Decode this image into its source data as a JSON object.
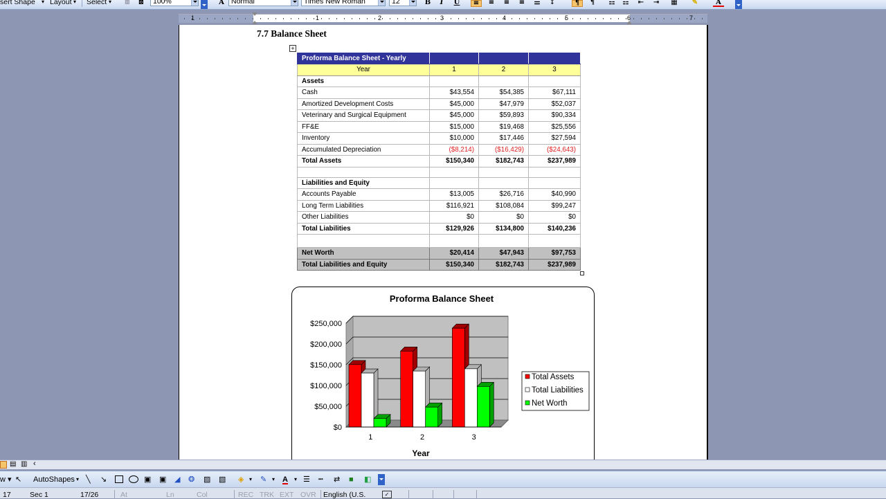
{
  "toolbar": {
    "insert_shape": "sert Shape",
    "layout": "Layout",
    "select": "Select",
    "zoom": "100%",
    "style": "Normal",
    "font": "Times New Roman",
    "size": "12",
    "bold": "B",
    "italic": "I",
    "underline": "U"
  },
  "ruler": {
    "numbers": [
      "1",
      "1",
      "2",
      "3",
      "4",
      "5",
      "6",
      "7"
    ]
  },
  "document": {
    "heading": "7.7 Balance Sheet",
    "table": {
      "title": "Proforma Balance Sheet - Yearly",
      "year_label": "Year",
      "years": [
        "1",
        "2",
        "3"
      ],
      "assets_header": "Assets",
      "assets": [
        {
          "label": "Cash",
          "values": [
            "$43,554",
            "$54,385",
            "$67,111"
          ]
        },
        {
          "label": "Amortized Development Costs",
          "values": [
            "$45,000",
            "$47,979",
            "$52,037"
          ]
        },
        {
          "label": "Veterinary and Surgical Equipment",
          "values": [
            "$45,000",
            "$59,893",
            "$90,334"
          ]
        },
        {
          "label": "FF&E",
          "values": [
            "$15,000",
            "$19,468",
            "$25,556"
          ]
        },
        {
          "label": "Inventory",
          "values": [
            "$10,000",
            "$17,446",
            "$27,594"
          ]
        },
        {
          "label": "Accumulated Depreciation",
          "values": [
            "($8,214)",
            "($16,429)",
            "($24,643)"
          ],
          "negative": true
        }
      ],
      "total_assets": {
        "label": "Total Assets",
        "values": [
          "$150,340",
          "$182,743",
          "$237,989"
        ]
      },
      "liabilities_header": "Liabilities and Equity",
      "liabilities": [
        {
          "label": "Accounts Payable",
          "values": [
            "$13,005",
            "$26,716",
            "$40,990"
          ]
        },
        {
          "label": "Long Term Liabilities",
          "values": [
            "$116,921",
            "$108,084",
            "$99,247"
          ]
        },
        {
          "label": "Other Liabilities",
          "values": [
            "$0",
            "$0",
            "$0"
          ]
        }
      ],
      "total_liabilities": {
        "label": "Total Liabilities",
        "values": [
          "$129,926",
          "$134,800",
          "$140,236"
        ]
      },
      "net_worth": {
        "label": "Net Worth",
        "values": [
          "$20,414",
          "$47,943",
          "$97,753"
        ]
      },
      "total_le": {
        "label": "Total Liabilities and Equity",
        "values": [
          "$150,340",
          "$182,743",
          "$237,989"
        ]
      }
    }
  },
  "chart_data": {
    "type": "bar",
    "title": "Proforma Balance Sheet",
    "xlabel": "Year",
    "ylabel": "",
    "categories": [
      "1",
      "2",
      "3"
    ],
    "ylim": [
      0,
      250000
    ],
    "yticks": [
      "$0",
      "$50,000",
      "$100,000",
      "$150,000",
      "$200,000",
      "$250,000"
    ],
    "grid": true,
    "legend": "right",
    "series": [
      {
        "name": "Total Assets",
        "color": "#ff0000",
        "values": [
          150340,
          182743,
          237989
        ]
      },
      {
        "name": "Total Liabilities",
        "color": "#ffffff",
        "values": [
          129926,
          134800,
          140236
        ]
      },
      {
        "name": "Net Worth",
        "color": "#00ff00",
        "values": [
          20414,
          47943,
          97753
        ]
      }
    ]
  },
  "draw_toolbar": {
    "autoshapes": "AutoShapes"
  },
  "status": {
    "page": "17",
    "section": "Sec 1",
    "pages": "17/26",
    "at": "At",
    "ln": "Ln",
    "col": "Col",
    "rec": "REC",
    "trk": "TRK",
    "ext": "EXT",
    "ovr": "OVR",
    "language": "English (U.S."
  }
}
